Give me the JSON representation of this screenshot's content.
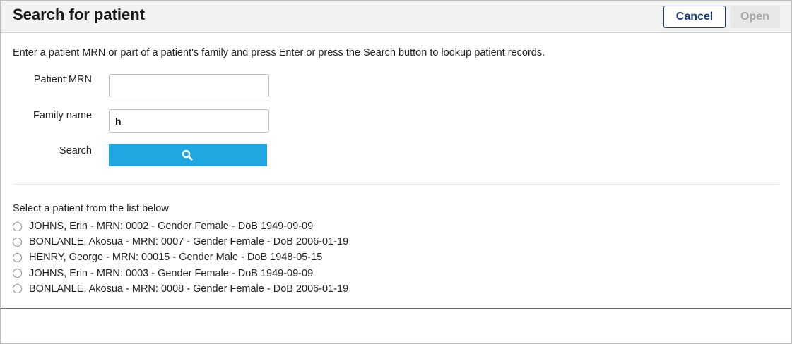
{
  "dialog": {
    "title": "Search for patient",
    "cancel_label": "Cancel",
    "open_label": "Open"
  },
  "instructions": "Enter a patient MRN or part of a patient's family and press Enter or press the Search button to lookup patient records.",
  "form": {
    "mrn_label": "Patient MRN",
    "mrn_value": "",
    "family_label": "Family name",
    "family_value": "h",
    "search_label": "Search",
    "search_icon": "search-icon"
  },
  "results": {
    "caption": "Select a patient from the list below",
    "patients": [
      {
        "label": "JOHNS, Erin - MRN: 0002 - Gender Female - DoB 1949-09-09"
      },
      {
        "label": "BONLANLE, Akosua - MRN: 0007 - Gender Female - DoB 2006-01-19"
      },
      {
        "label": "HENRY, George - MRN: 00015 - Gender Male - DoB 1948-05-15"
      },
      {
        "label": "JOHNS, Erin - MRN: 0003 - Gender Female - DoB 1949-09-09"
      },
      {
        "label": "BONLANLE, Akosua - MRN: 0008 - Gender Female - DoB 2006-01-19"
      }
    ]
  },
  "colors": {
    "primary": "#1d3b7a",
    "search_button": "#1ea7e1",
    "disabled": "#a8a8a8"
  }
}
